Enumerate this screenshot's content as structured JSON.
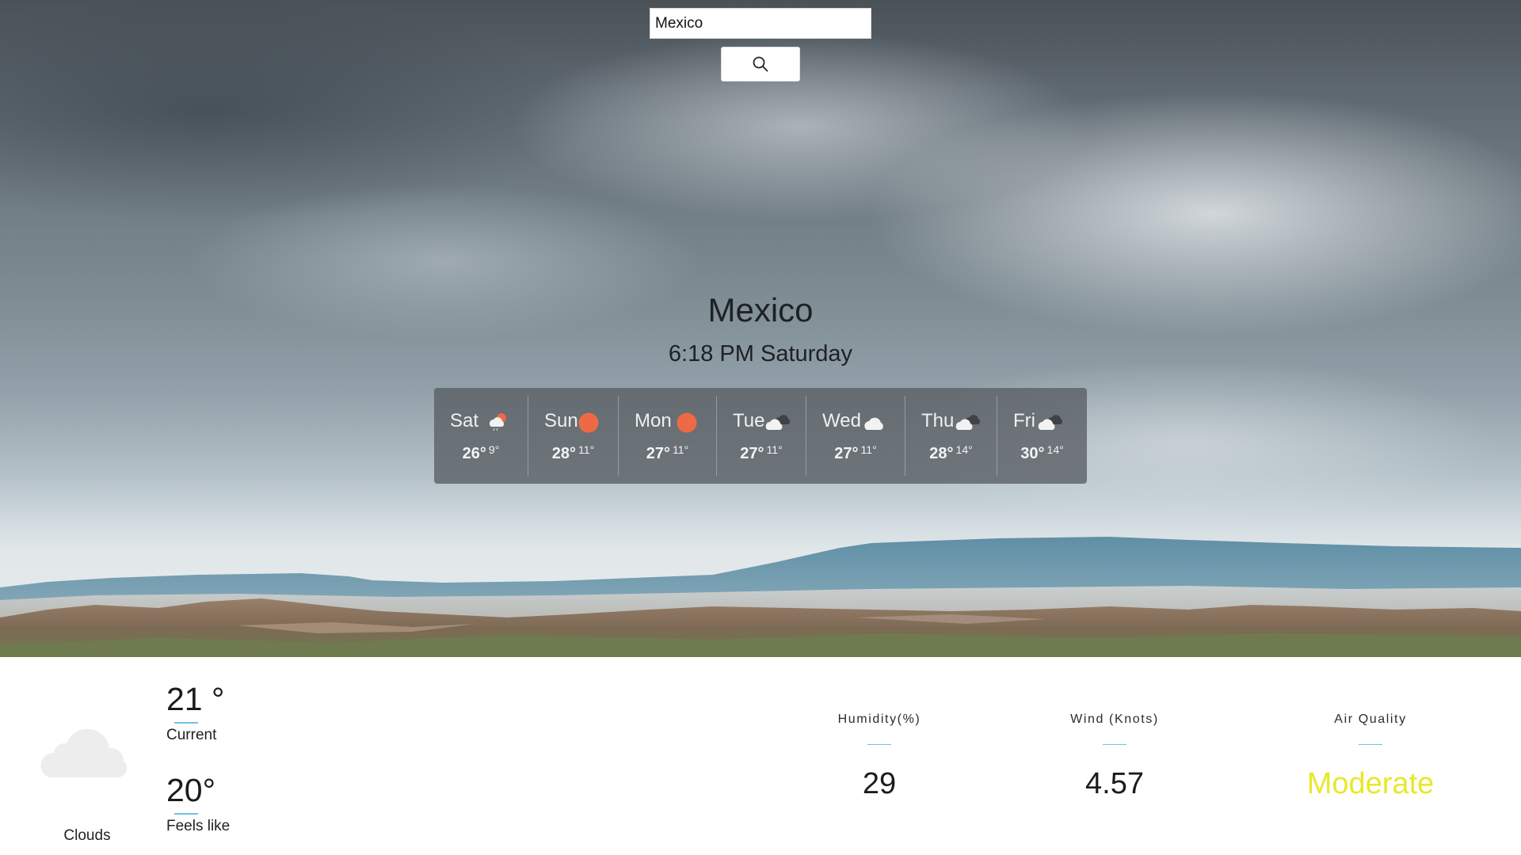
{
  "search": {
    "value": "Mexico",
    "button_icon": "search-icon"
  },
  "location": {
    "city": "Mexico",
    "datetime": "6:18 PM Saturday"
  },
  "forecast": [
    {
      "day": "Sat",
      "high": "26°",
      "low": "9°",
      "icon": "sun-cloud-rain-icon"
    },
    {
      "day": "Sun",
      "high": "28°",
      "low": "11°",
      "icon": "sun-icon"
    },
    {
      "day": "Mon",
      "high": "27°",
      "low": "11°",
      "icon": "sun-icon"
    },
    {
      "day": "Tue",
      "high": "27°",
      "low": "11°",
      "icon": "clouds-icon"
    },
    {
      "day": "Wed",
      "high": "27°",
      "low": "11°",
      "icon": "cloud-icon"
    },
    {
      "day": "Thu",
      "high": "28°",
      "low": "14°",
      "icon": "clouds-icon"
    },
    {
      "day": "Fri",
      "high": "30°",
      "low": "14°",
      "icon": "clouds-icon"
    }
  ],
  "current": {
    "condition": "Clouds",
    "condition_icon": "cloud-icon",
    "temp": "21 °",
    "temp_label": "Current",
    "feels_like": "20°",
    "feels_like_label": "Feels like"
  },
  "stats": {
    "humidity_label": "Humidity(%)",
    "humidity_value": "29",
    "wind_label": "Wind (Knots)",
    "wind_value": "4.57",
    "air_label": "Air Quality",
    "air_value": "Moderate"
  },
  "colors": {
    "sun": "#ee6a45",
    "air_quality_moderate": "#e8e82a",
    "accent_line": "#6ec3e6",
    "forecast_panel": "#585e63"
  }
}
